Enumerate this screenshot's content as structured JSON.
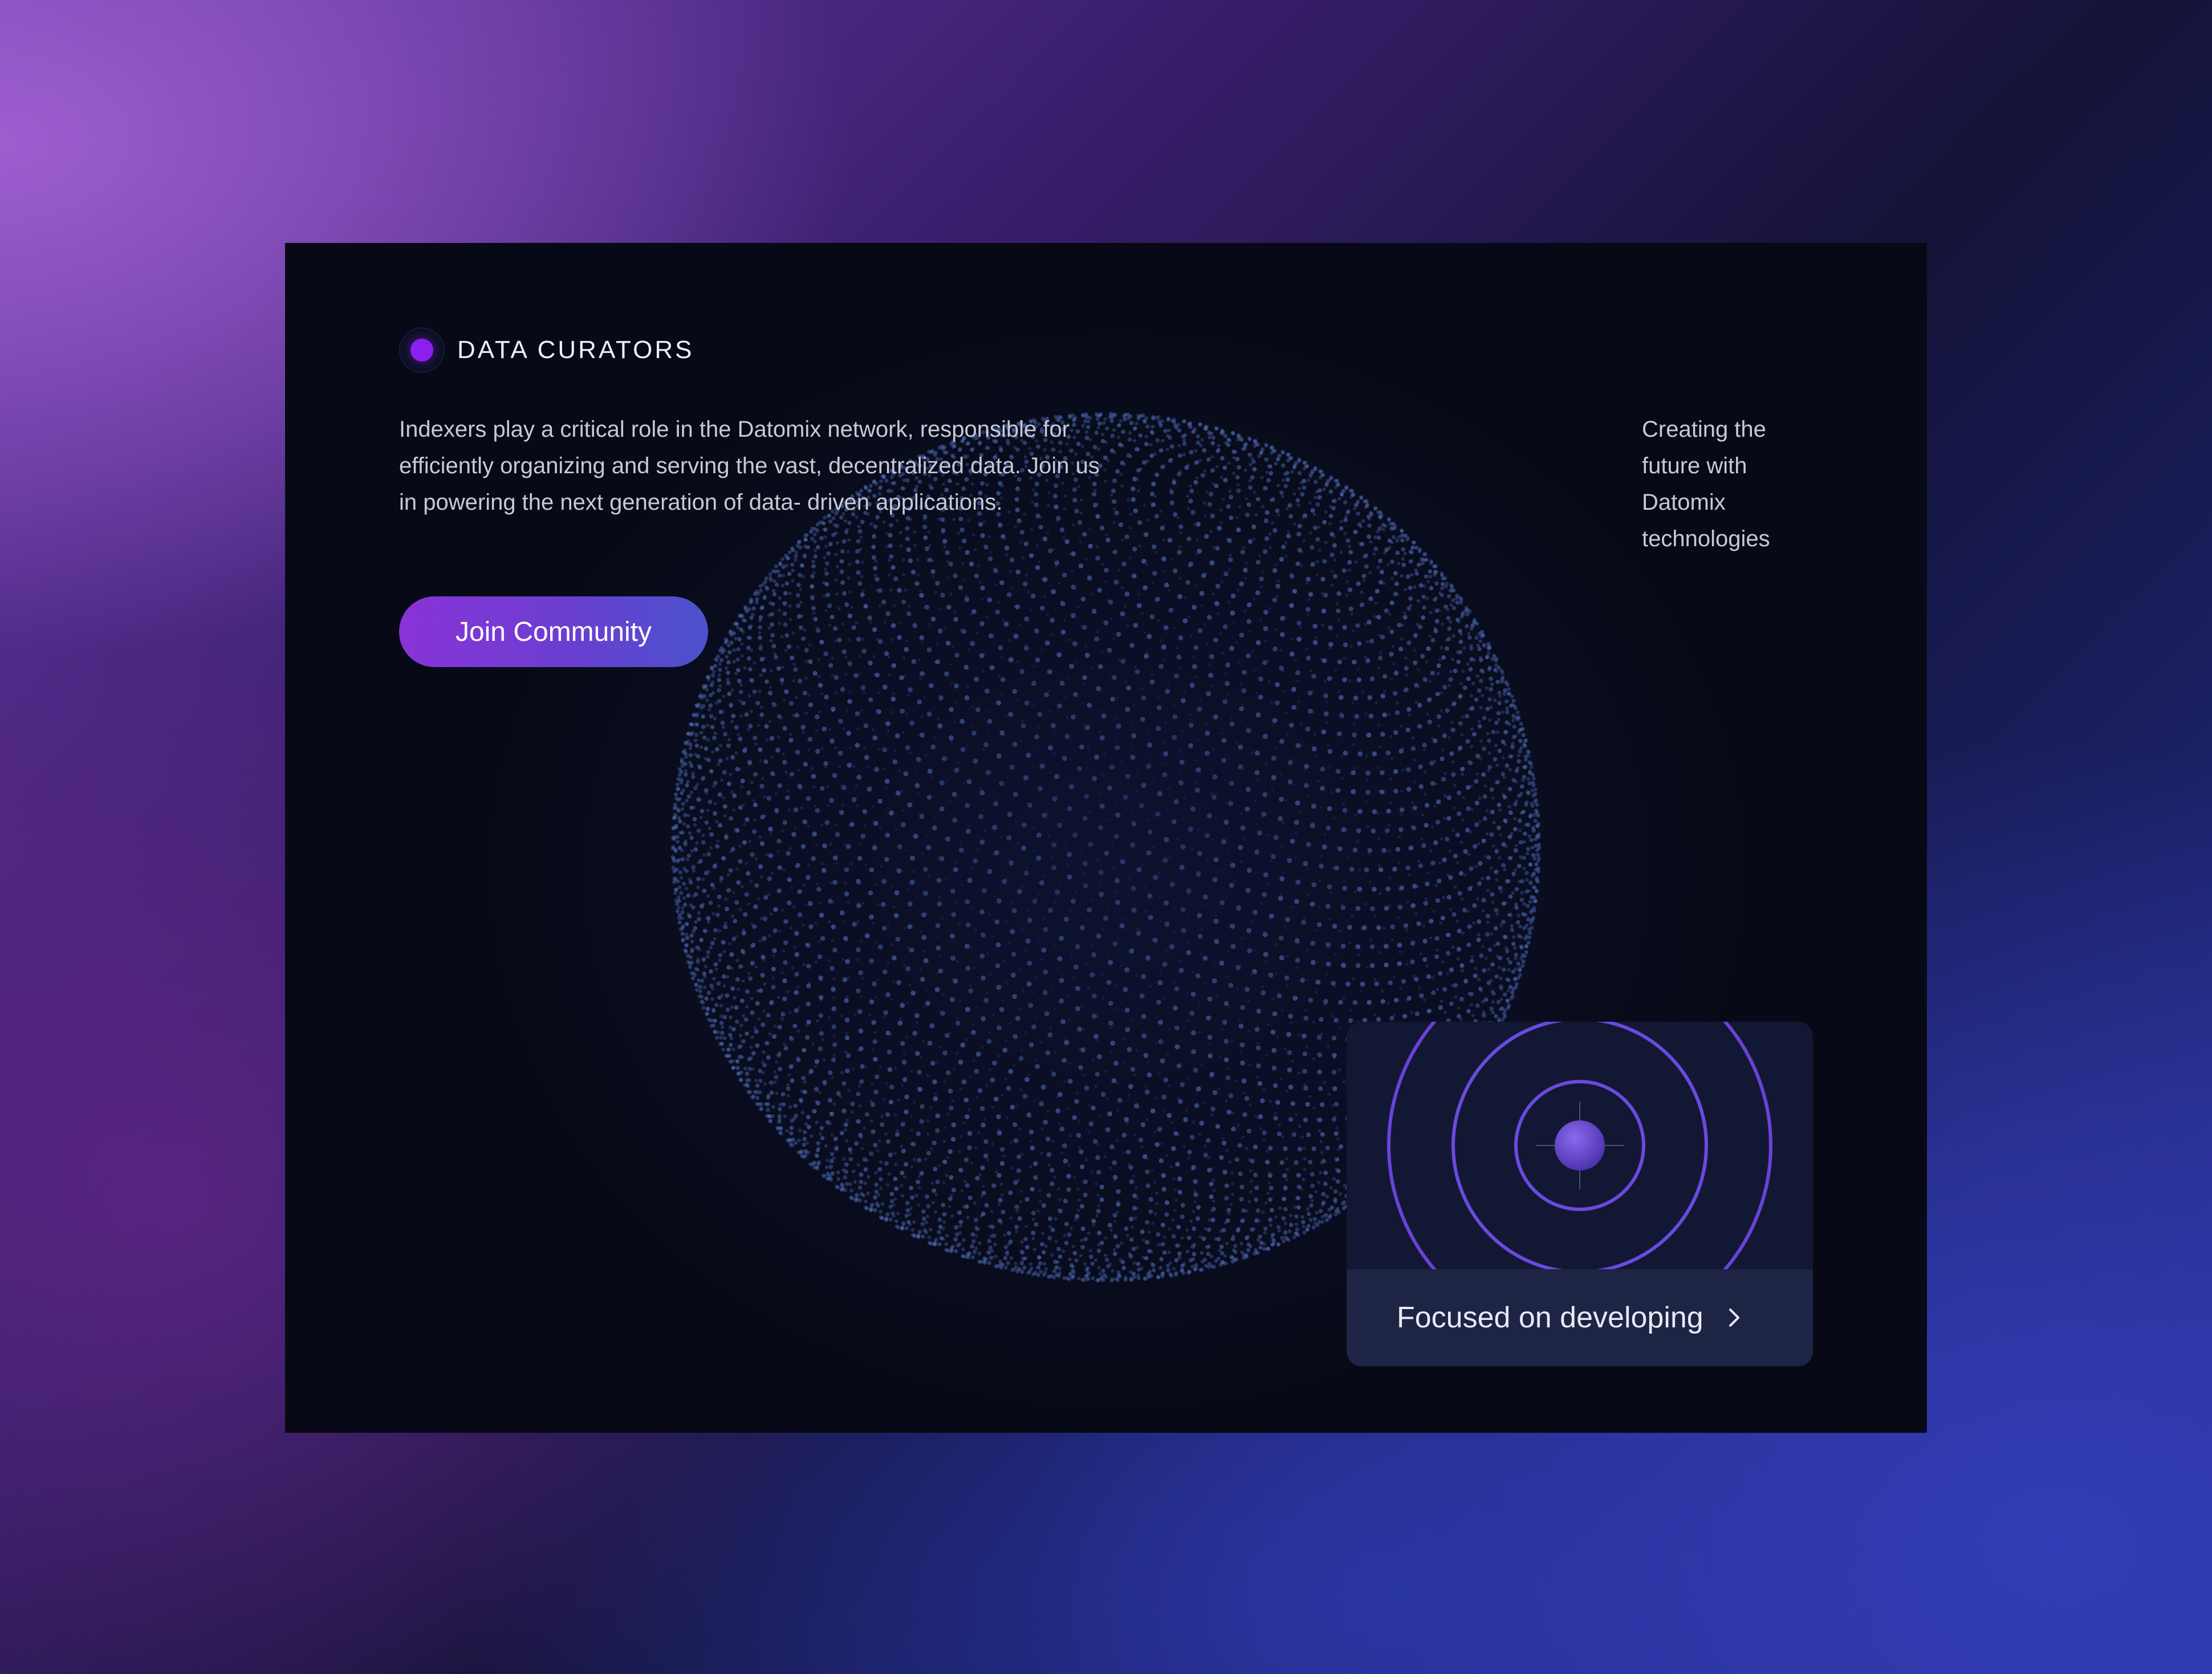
{
  "section": {
    "tag_label": "DATA CURATORS",
    "description": "Indexers play a critical role in the Datomix network, responsible for efficiently organizing and serving  the vast, decentralized data. Join us in powering the next generation of data- driven applications.",
    "side_text": "Creating the future with Datomix technologies",
    "join_button_label": "Join Community"
  },
  "feature_card": {
    "label": "Focused on developing",
    "icon": "chevron-right-icon"
  },
  "colors": {
    "accent": "#8a1ff0",
    "button_gradient_start": "#8a33d8",
    "button_gradient_end": "#4a52cc",
    "ring": "#6a4ae0",
    "card_bg": "#070a16"
  }
}
